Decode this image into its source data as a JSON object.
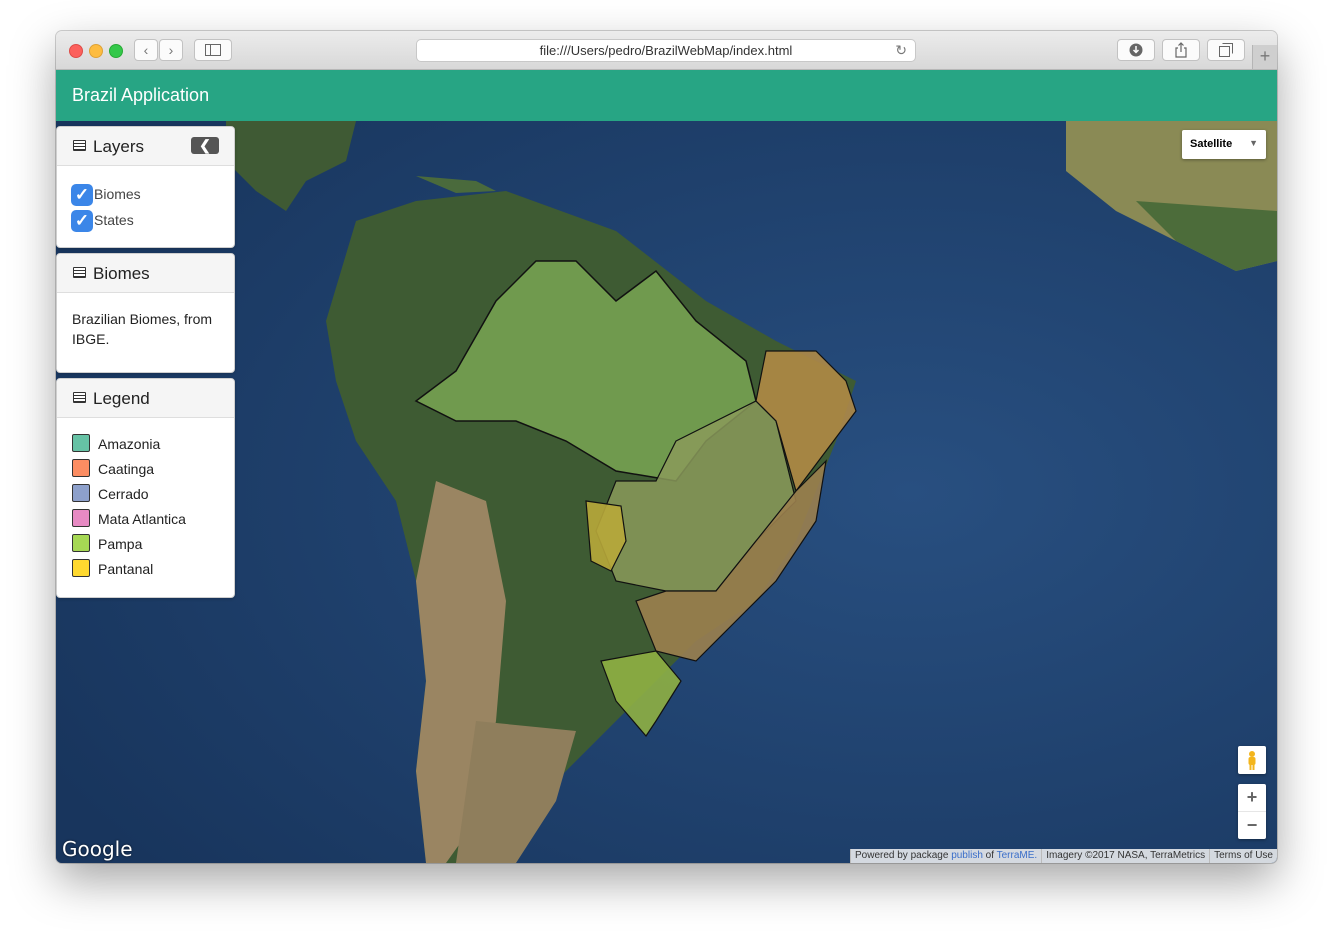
{
  "browser": {
    "url": "file:///Users/pedro/BrazilWebMap/index.html"
  },
  "app": {
    "title": "Brazil Application"
  },
  "layers_panel": {
    "title": "Layers",
    "items": [
      {
        "label": "Biomes",
        "checked": true
      },
      {
        "label": "States",
        "checked": true
      }
    ]
  },
  "biomes_panel": {
    "title": "Biomes",
    "description": "Brazilian Biomes, from IBGE."
  },
  "legend_panel": {
    "title": "Legend",
    "items": [
      {
        "label": "Amazonia",
        "color": "#66c2a5"
      },
      {
        "label": "Caatinga",
        "color": "#fc8d62"
      },
      {
        "label": "Cerrado",
        "color": "#8da0cb"
      },
      {
        "label": "Mata Atlantica",
        "color": "#e78ac3"
      },
      {
        "label": "Pampa",
        "color": "#a6d854"
      },
      {
        "label": "Pantanal",
        "color": "#ffd92f"
      }
    ]
  },
  "map_controls": {
    "map_type": "Satellite",
    "zoom_in": "+",
    "zoom_out": "−",
    "google": "Google"
  },
  "attribution": {
    "powered_prefix": "Powered by package",
    "publish_link": "publish",
    "of_text": "of",
    "terrame_link": "TerraME.",
    "imagery": "Imagery ©2017 NASA, TerraMetrics",
    "terms": "Terms of Use"
  }
}
